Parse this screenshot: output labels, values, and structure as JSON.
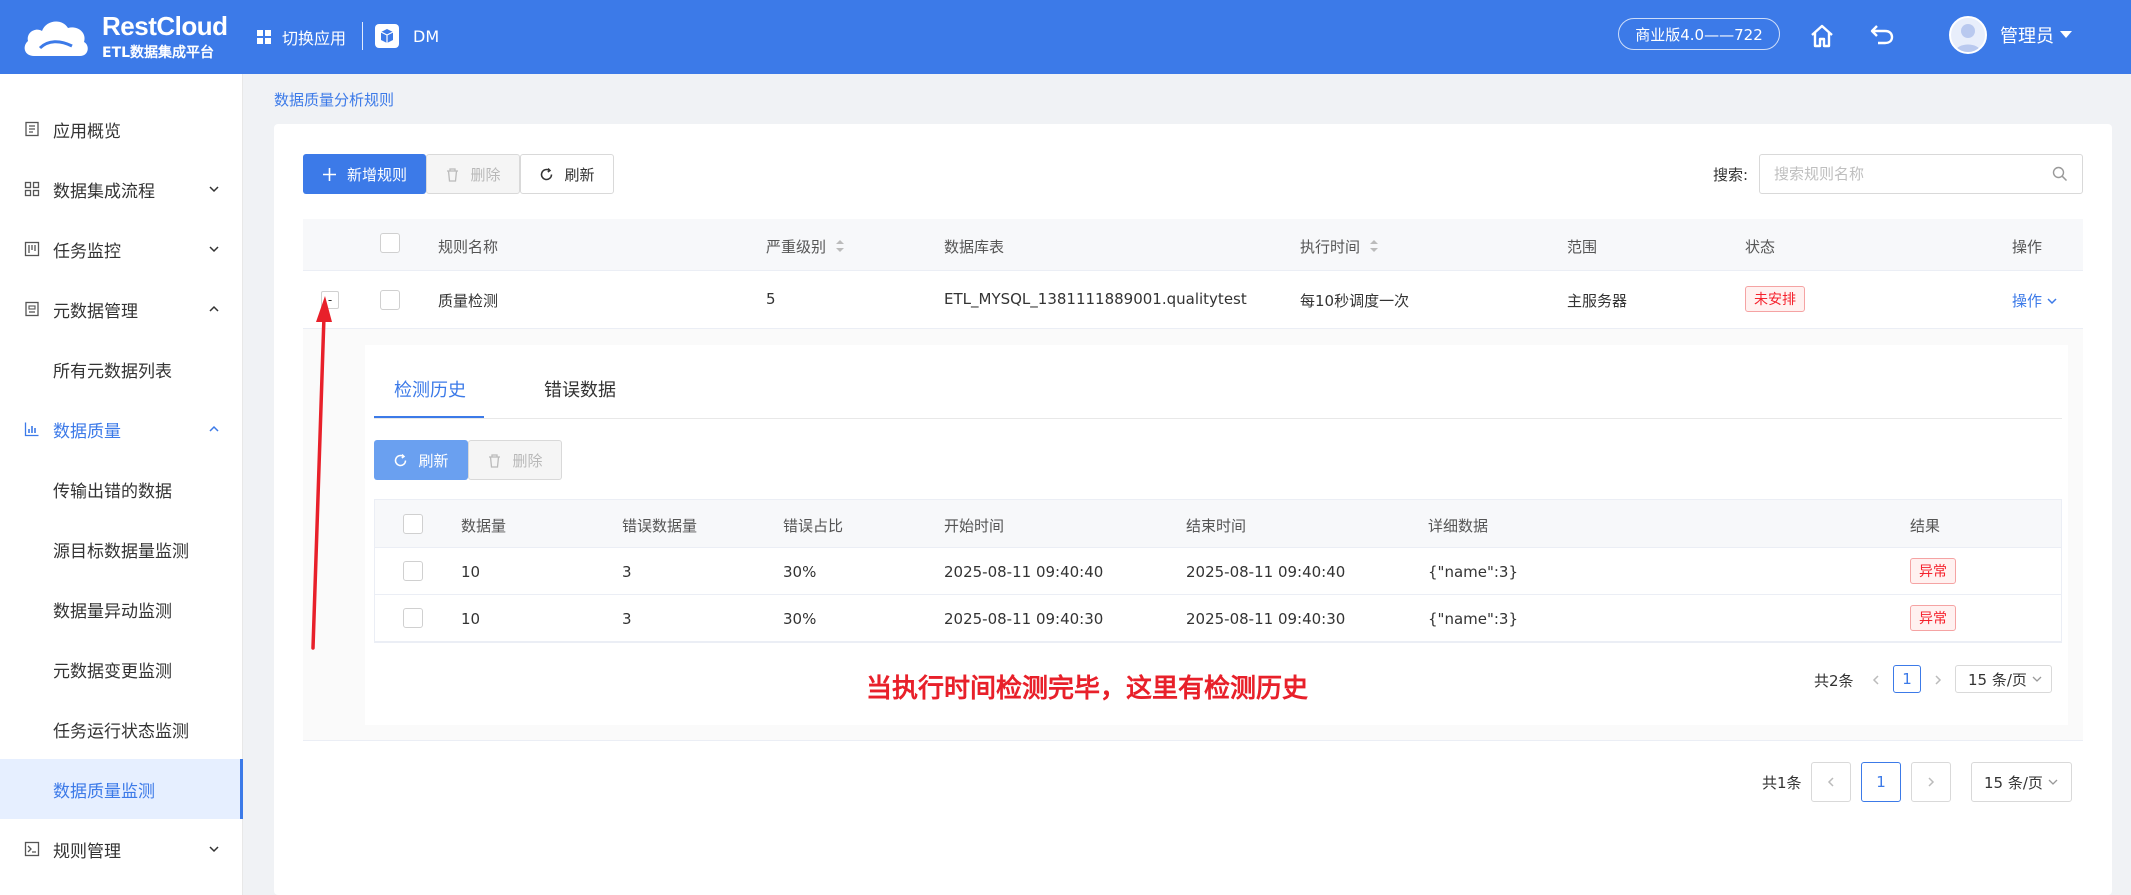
{
  "header": {
    "brand_title": "RestCloud",
    "brand_subtitle": "ETL数据集成平台",
    "switch_app": "切换应用",
    "app_name": "DM",
    "version": "商业版4.0——722",
    "user": "管理员"
  },
  "sidebar": {
    "items": [
      {
        "label": "应用概览"
      },
      {
        "label": "数据集成流程"
      },
      {
        "label": "任务监控"
      },
      {
        "label": "元数据管理"
      },
      {
        "label": "所有元数据列表"
      },
      {
        "label": "数据质量"
      },
      {
        "label": "传输出错的数据"
      },
      {
        "label": "源目标数据量监测"
      },
      {
        "label": "数据量异动监测"
      },
      {
        "label": "元数据变更监测"
      },
      {
        "label": "任务运行状态监测"
      },
      {
        "label": "数据质量监测"
      },
      {
        "label": "规则管理"
      }
    ]
  },
  "breadcrumb": "数据质量分析规则",
  "toolbar": {
    "add": "新增规则",
    "delete": "删除",
    "refresh": "刷新",
    "search_label": "搜索:",
    "search_placeholder": "搜索规则名称"
  },
  "table": {
    "headers": [
      "规则名称",
      "严重级别",
      "数据库表",
      "执行时间",
      "范围",
      "状态",
      "操作"
    ],
    "rows": [
      {
        "expand": "-",
        "name": "质量检测",
        "level": "5",
        "db_table": "ETL_MYSQL_1381111889001.qualitytest",
        "schedule": "每10秒调度一次",
        "scope": "主服务器",
        "status": "未安排",
        "action": "操作"
      }
    ]
  },
  "detail": {
    "tabs": [
      "检测历史",
      "错误数据"
    ],
    "refresh": "刷新",
    "delete": "删除",
    "headers": [
      "数据量",
      "错误数据量",
      "错误占比",
      "开始时间",
      "结束时间",
      "详细数据",
      "结果"
    ],
    "rows": [
      {
        "count": "10",
        "errors": "3",
        "ratio": "30%",
        "start": "2025-08-11 09:40:40",
        "end": "2025-08-11 09:40:40",
        "detail": "{\"name\":3}",
        "result": "异常"
      },
      {
        "count": "10",
        "errors": "3",
        "ratio": "30%",
        "start": "2025-08-11 09:40:30",
        "end": "2025-08-11 09:40:30",
        "detail": "{\"name\":3}",
        "result": "异常"
      }
    ],
    "total": "共2条",
    "page": "1",
    "page_size": "15 条/页"
  },
  "pagination": {
    "total": "共1条",
    "page": "1",
    "page_size": "15 条/页"
  },
  "annotation": "当执行时间检测完毕，这里有检测历史",
  "colors": {
    "primary": "#3c7ae8",
    "danger": "#f5222d",
    "annotation": "#e8202a"
  }
}
